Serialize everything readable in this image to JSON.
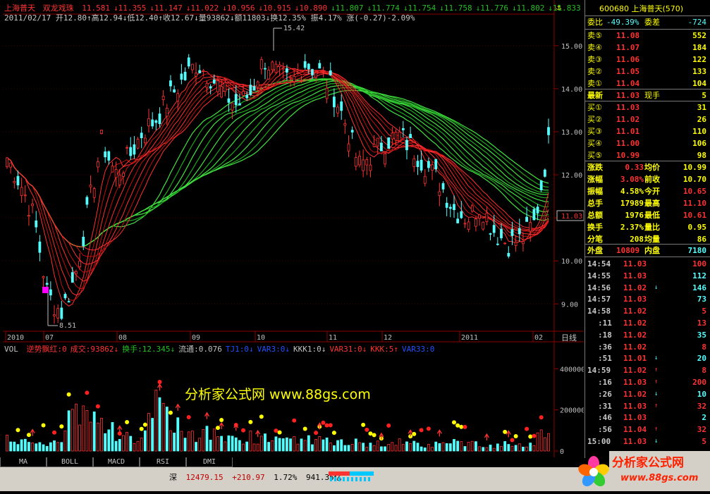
{
  "colors": {
    "up": "#ff3232",
    "down": "#54ffff",
    "bull_band": "#22c022",
    "bear_band": "#ff2020",
    "yellow": "#ffff00",
    "magenta": "#ff00ff",
    "cyan": "#00ffff"
  },
  "header": {
    "stock_name": "上海普天",
    "indicator": "双龙戏珠",
    "values_row": [
      "11.581",
      "11.355",
      "11.147",
      "11.022",
      "10.956",
      "10.915",
      "10.890",
      "11.807",
      "11.774",
      "11.754",
      "11.758",
      "11.776",
      "11.802",
      "11.833"
    ],
    "info_row": "2011/02/17  开12.80↑高12.94↓低12.40↑收12.67↓量93862↓额11803↓换12.35% 振4.17% 涨(-0.27)-2.09%"
  },
  "chart_data": {
    "type": "candlestick",
    "price_axis": {
      "ticks": [
        "15.00",
        "14.00",
        "13.00",
        "12.00",
        "11.00",
        "10.00",
        "9.00"
      ],
      "ylim": [
        8.4,
        15.7
      ]
    },
    "time_axis": {
      "labels": [
        "2010",
        "07",
        "08",
        "09",
        "10",
        "11",
        "12",
        "2011",
        "02"
      ],
      "unit_label": "日线"
    },
    "annotations": {
      "high": "15.42",
      "low": "8.51",
      "last_price": "11.03"
    },
    "trend": [
      12.4,
      11.8,
      11.0,
      9.2,
      8.8,
      9.6,
      11.2,
      12.8,
      12.0,
      12.4,
      13.0,
      13.3,
      13.8,
      14.2,
      14.6,
      14.3,
      13.9,
      13.6,
      13.9,
      14.7,
      14.3,
      14.1,
      14.6,
      14.4,
      14.0,
      13.2,
      12.2,
      12.5,
      12.8,
      12.9,
      12.6,
      12.2,
      11.8,
      11.2,
      11.0,
      11.3,
      10.7,
      10.4,
      10.5,
      10.9,
      12.7
    ],
    "volume_axis": {
      "ticks": [
        "400000",
        "200000",
        "0"
      ],
      "ylim": [
        0,
        480000
      ]
    },
    "volume": [
      80,
      60,
      50,
      40,
      30,
      220,
      160,
      120,
      90,
      70,
      60,
      200,
      140,
      100,
      80,
      90,
      60,
      50,
      70,
      60,
      50,
      45,
      60,
      50,
      40,
      45,
      40,
      35,
      30,
      40,
      35,
      30,
      30,
      40,
      35,
      30,
      25,
      35,
      30,
      40,
      140
    ]
  },
  "volume_header": {
    "label": "VOL",
    "items": [
      {
        "text": "逆势飘红:0",
        "color": "#ff3232"
      },
      {
        "text": "成交:93862↓",
        "color": "#ff3232"
      },
      {
        "text": "换手:12.345↓",
        "color": "#22c022"
      },
      {
        "text": "流通:0.076",
        "color": "#c0c0c0"
      },
      {
        "text": "TJ1:0↓",
        "color": "#2050ff"
      },
      {
        "text": "VAR3:0↓",
        "color": "#2050ff"
      },
      {
        "text": "KKK1:0↓",
        "color": "#c0c0c0"
      },
      {
        "text": "VAR31:0↓",
        "color": "#ff3232"
      },
      {
        "text": "KKK:5↑",
        "color": "#ff3232"
      },
      {
        "text": "VAR33:0",
        "color": "#2050ff"
      }
    ]
  },
  "watermark": "分析家公式网 www.88gs.com",
  "tabs": [
    "MA",
    "BOLL",
    "MACD",
    "RSI",
    "DMI"
  ],
  "status_bar": {
    "market": "深",
    "index": "12479.15",
    "change": "+210.97",
    "pct": "1.72%",
    "amount": "941.35亿"
  },
  "quote": {
    "code_title": "600680 上海普天(570)",
    "weibi_label": "委比",
    "weibi_value": "-49.39%",
    "weicha_label": "委差",
    "weicha_value": "-724",
    "sell": [
      {
        "label": "卖⑤",
        "price": "11.08",
        "vol": "552"
      },
      {
        "label": "卖④",
        "price": "11.07",
        "vol": "184"
      },
      {
        "label": "卖③",
        "price": "11.06",
        "vol": "122"
      },
      {
        "label": "卖②",
        "price": "11.05",
        "vol": "133"
      },
      {
        "label": "卖①",
        "price": "11.04",
        "vol": "104"
      }
    ],
    "latest_label": "最新",
    "latest_price": "11.03",
    "xianshou_label": "现手",
    "xianshou_value": "5",
    "buy": [
      {
        "label": "买①",
        "price": "11.03",
        "vol": "31"
      },
      {
        "label": "买②",
        "price": "11.02",
        "vol": "26"
      },
      {
        "label": "买③",
        "price": "11.01",
        "vol": "110"
      },
      {
        "label": "买④",
        "price": "11.00",
        "vol": "106"
      },
      {
        "label": "买⑤",
        "price": "10.99",
        "vol": "98"
      }
    ],
    "stats": [
      {
        "l1": "涨跌",
        "v1": "0.33",
        "l2": "均价",
        "v2": "10.99"
      },
      {
        "l1": "涨幅",
        "v1": "3.08%",
        "l2": "前收",
        "v2": "10.70"
      },
      {
        "l1": "振幅",
        "v1": "4.58%",
        "l2": "今开",
        "v2": "10.65"
      },
      {
        "l1": "总手",
        "v1": "17989",
        "l2": "最高",
        "v2": "11.10"
      },
      {
        "l1": "总额",
        "v1": "1976",
        "l2": "最低",
        "v2": "10.61"
      },
      {
        "l1": "换手",
        "v1": "2.37%",
        "l2": "量比",
        "v2": "0.95"
      },
      {
        "l1": "分笔",
        "v1": "208",
        "l2": "均量",
        "v2": "86"
      }
    ],
    "waipan_label": "外盘",
    "waipan_value": "10809",
    "neipan_label": "内盘",
    "neipan_value": "7180",
    "ticks": [
      {
        "time": "14:54",
        "price": "11.03",
        "arrow": "",
        "vol": "100",
        "vc": "#ff3232"
      },
      {
        "time": "14:55",
        "price": "11.03",
        "arrow": "",
        "vol": "112",
        "vc": "#54ffff"
      },
      {
        "time": "14:56",
        "price": "11.02",
        "arrow": "↓",
        "vol": "146",
        "vc": "#54ffff"
      },
      {
        "time": "14:57",
        "price": "11.03",
        "arrow": "",
        "vol": "73",
        "vc": "#54ffff"
      },
      {
        "time": "14:58",
        "price": "11.02",
        "arrow": "",
        "vol": "5",
        "vc": "#ff3232"
      },
      {
        "time": ":11",
        "price": "11.02",
        "arrow": "",
        "vol": "13",
        "vc": "#ff3232"
      },
      {
        "time": ":18",
        "price": "11.02",
        "arrow": "",
        "vol": "35",
        "vc": "#54ffff"
      },
      {
        "time": ":36",
        "price": "11.02",
        "arrow": "",
        "vol": "8",
        "vc": "#ff3232"
      },
      {
        "time": ":51",
        "price": "11.01",
        "arrow": "↓",
        "vol": "20",
        "vc": "#54ffff"
      },
      {
        "time": "14:59",
        "price": "11.02",
        "arrow": "↑",
        "vol": "8",
        "vc": "#ff3232"
      },
      {
        "time": ":16",
        "price": "11.03",
        "arrow": "↑",
        "vol": "200",
        "vc": "#ff3232"
      },
      {
        "time": ":26",
        "price": "11.02",
        "arrow": "↓",
        "vol": "10",
        "vc": "#54ffff"
      },
      {
        "time": ":31",
        "price": "11.03",
        "arrow": "↑",
        "vol": "32",
        "vc": "#ff3232"
      },
      {
        "time": ":46",
        "price": "11.03",
        "arrow": "",
        "vol": "2",
        "vc": "#54ffff"
      },
      {
        "time": ":56",
        "price": "11.04",
        "arrow": "↑",
        "vol": "32",
        "vc": "#ff3232"
      },
      {
        "time": "15:00",
        "price": "11.03",
        "arrow": "↓",
        "vol": "5",
        "vc": "#ff3232"
      }
    ]
  },
  "logo": {
    "text": "分析家公式网",
    "url": "www.88gs.com"
  }
}
